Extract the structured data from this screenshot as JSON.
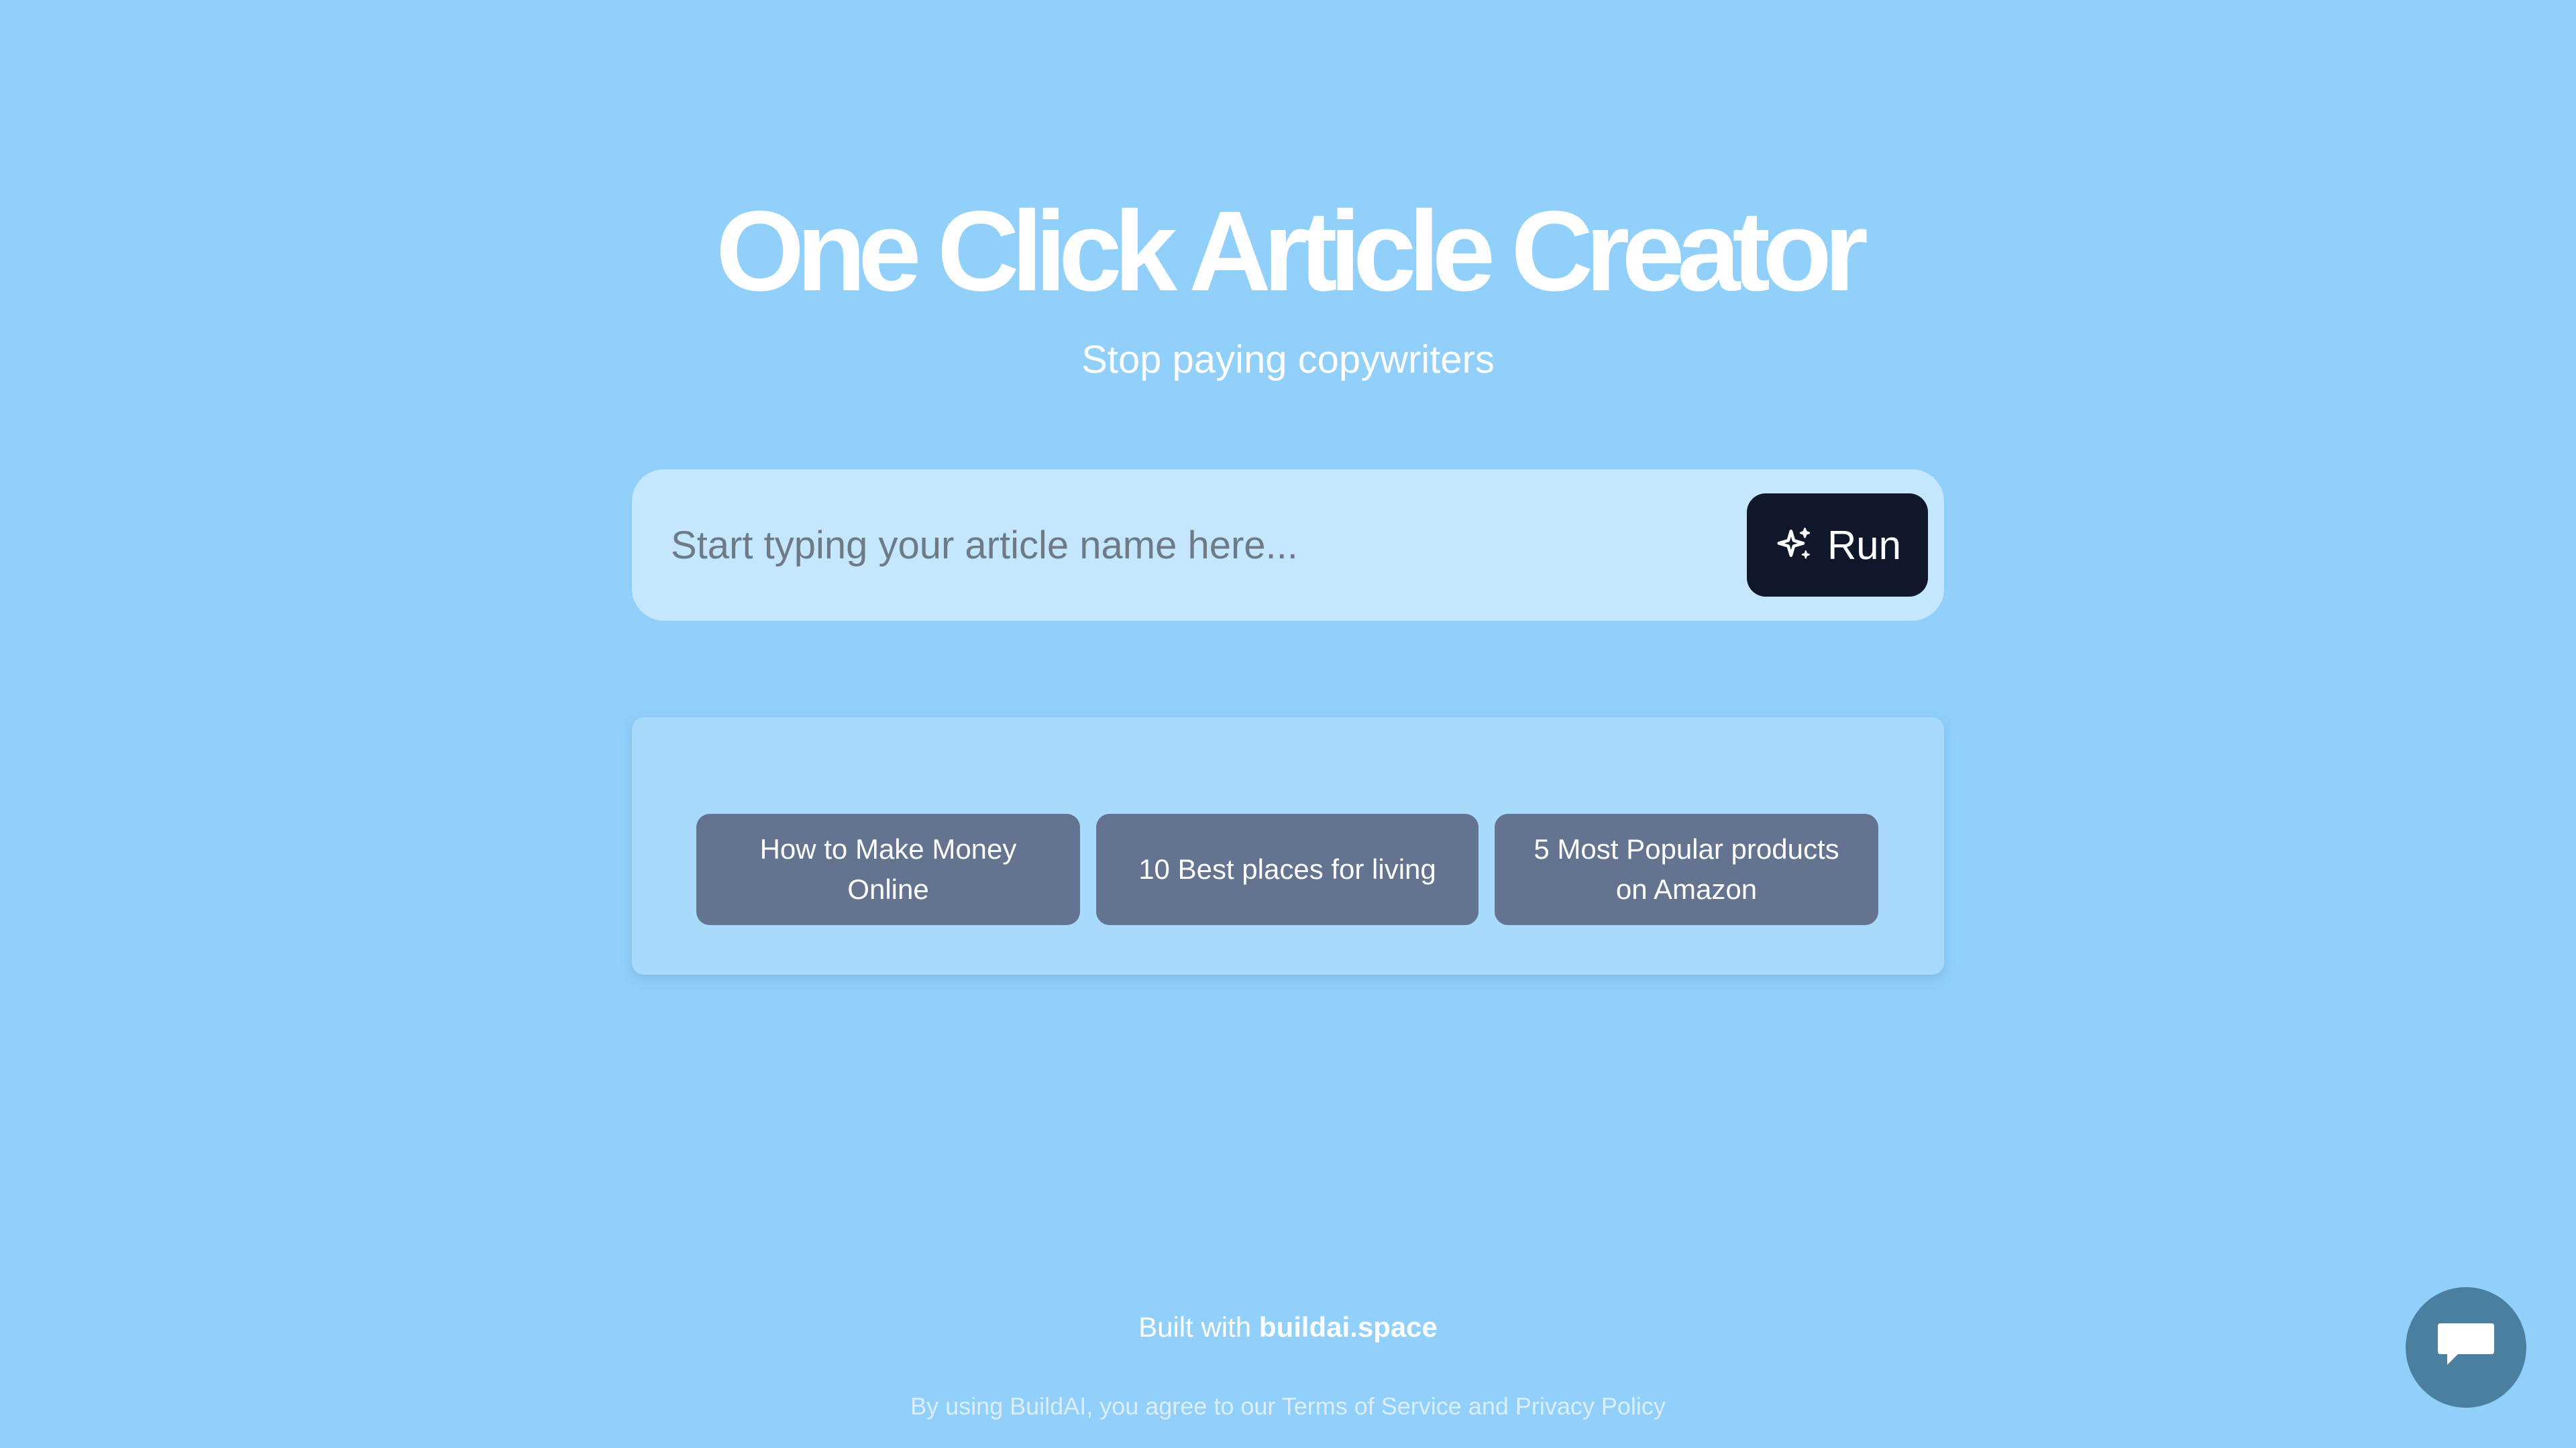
{
  "hero": {
    "title": "One Click Article Creator",
    "subtitle": "Stop paying copywriters"
  },
  "search": {
    "placeholder": "Start typing your article name here...",
    "value": "",
    "run_label": "Run",
    "run_icon": "sparkles-icon"
  },
  "suggestions": [
    {
      "label": "How to Make Money Online"
    },
    {
      "label": "10 Best places for living"
    },
    {
      "label": "5 Most Popular products on Amazon"
    }
  ],
  "footer": {
    "built_prefix": "Built with ",
    "built_link": "buildai.space",
    "terms": "By using BuildAI, you agree to our Terms of Service and Privacy Policy"
  },
  "chat": {
    "icon": "chat-bubble-icon"
  },
  "colors": {
    "background": "#90d0fa",
    "search_box": "#c5e7fd",
    "run_button": "#0f172a",
    "panel": "#a8dafc",
    "suggestion": "#64738f",
    "chat_button": "#4a7f9f"
  }
}
